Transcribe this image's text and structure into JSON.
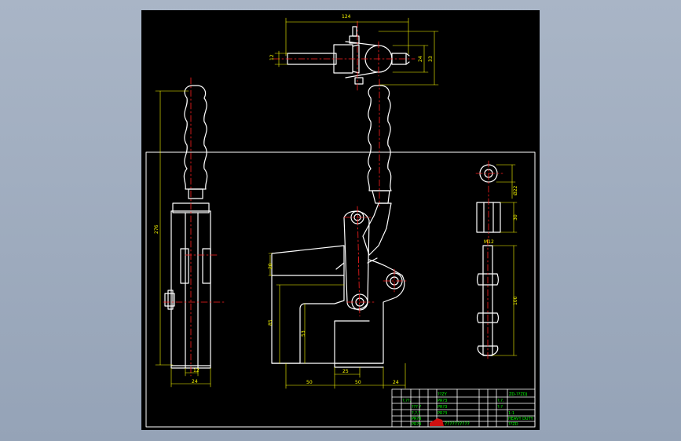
{
  "colors": {
    "background": "#9aa7ba",
    "sheet": "#000000",
    "outline": "#ffffff",
    "dimension": "#ffff00",
    "centerline": "#ff2020",
    "titleblock_text": "#00ff00",
    "logo": "#d01010"
  },
  "dimensions": {
    "top_overall": "124",
    "top_left": "12",
    "top_right_inner": "24",
    "top_right_outer": "33",
    "side_height": "276",
    "side_width_outer": "24",
    "side_width_inner": "12",
    "front_upper": "20",
    "front_height": "85",
    "front_inner": "53",
    "front_bottom_left": "50",
    "front_bottom_center": "25",
    "front_bottom_mid": "50",
    "front_bottom_right": "24",
    "bushing_dia": "Ø22",
    "bushing_len": "30",
    "bolt_thread": "M12",
    "bolt_len": "100"
  },
  "title_block": {
    "c1": "??ZY",
    "c2": "ZD-??ZDJ",
    "c3": "?,??,",
    "c4": "PR?3",
    "c5": "?,?,",
    "c6": "??? ?",
    "c7": "PR?3",
    "c8": "?:?",
    "c9": "?,?,?",
    "c10": "PR?3",
    "c11": "1:1",
    "c12": "PR?3",
    "c13": "HEAVY DUTY",
    "c14": "PR?3",
    "c15": "??ZD",
    "footer": "??????????"
  }
}
